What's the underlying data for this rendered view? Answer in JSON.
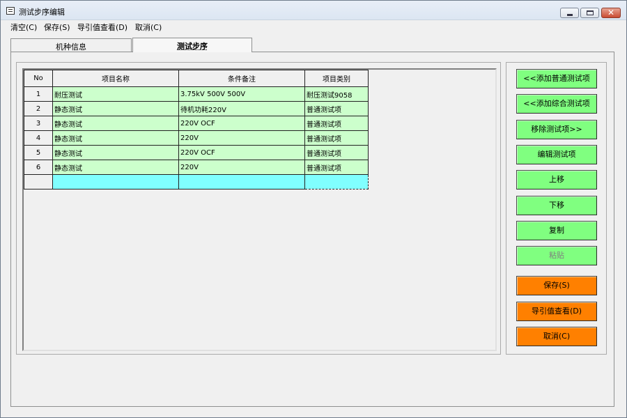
{
  "window": {
    "title": "测试步序编辑",
    "app_icon": "document-icon"
  },
  "menu": [
    "清空(C)",
    "保存(S)",
    "导引值查看(D)",
    "取消(C)"
  ],
  "tabs": [
    {
      "label": "机种信息",
      "active": false
    },
    {
      "label": "测试步序",
      "active": true
    }
  ],
  "grid": {
    "columns": [
      "No",
      "项目名称",
      "条件备注",
      "项目类别"
    ],
    "rows": [
      {
        "no": "1",
        "name": "耐压测试",
        "note": "3.75kV 500V 500V",
        "category": "耐压测试9058"
      },
      {
        "no": "2",
        "name": "静态测试",
        "note": "待机功耗220V",
        "category": "普通测试项"
      },
      {
        "no": "3",
        "name": "静态测试",
        "note": "220V OCF",
        "category": "普通测试项"
      },
      {
        "no": "4",
        "name": "静态测试",
        "note": "220V",
        "category": "普通测试项"
      },
      {
        "no": "5",
        "name": "静态测试",
        "note": "220V OCF",
        "category": "普通测试项"
      },
      {
        "no": "6",
        "name": "静态测试",
        "note": "220V",
        "category": "普通测试项"
      }
    ],
    "colors": {
      "row_fill": "#ccffcc",
      "new_row_fill": "#80ffff"
    }
  },
  "buttons": {
    "add_normal": "<<添加普通测试项",
    "add_combined": "<<添加综合测试项",
    "remove": "移除测试项>>",
    "edit": "编辑测试项",
    "move_up": "上移",
    "move_down": "下移",
    "copy": "复制",
    "paste": "粘贴",
    "save": "保存(S)",
    "view_guide": "导引值查看(D)",
    "cancel": "取消(C)"
  },
  "colors": {
    "green_button": "#80ff80",
    "orange_button": "#ff8000"
  }
}
